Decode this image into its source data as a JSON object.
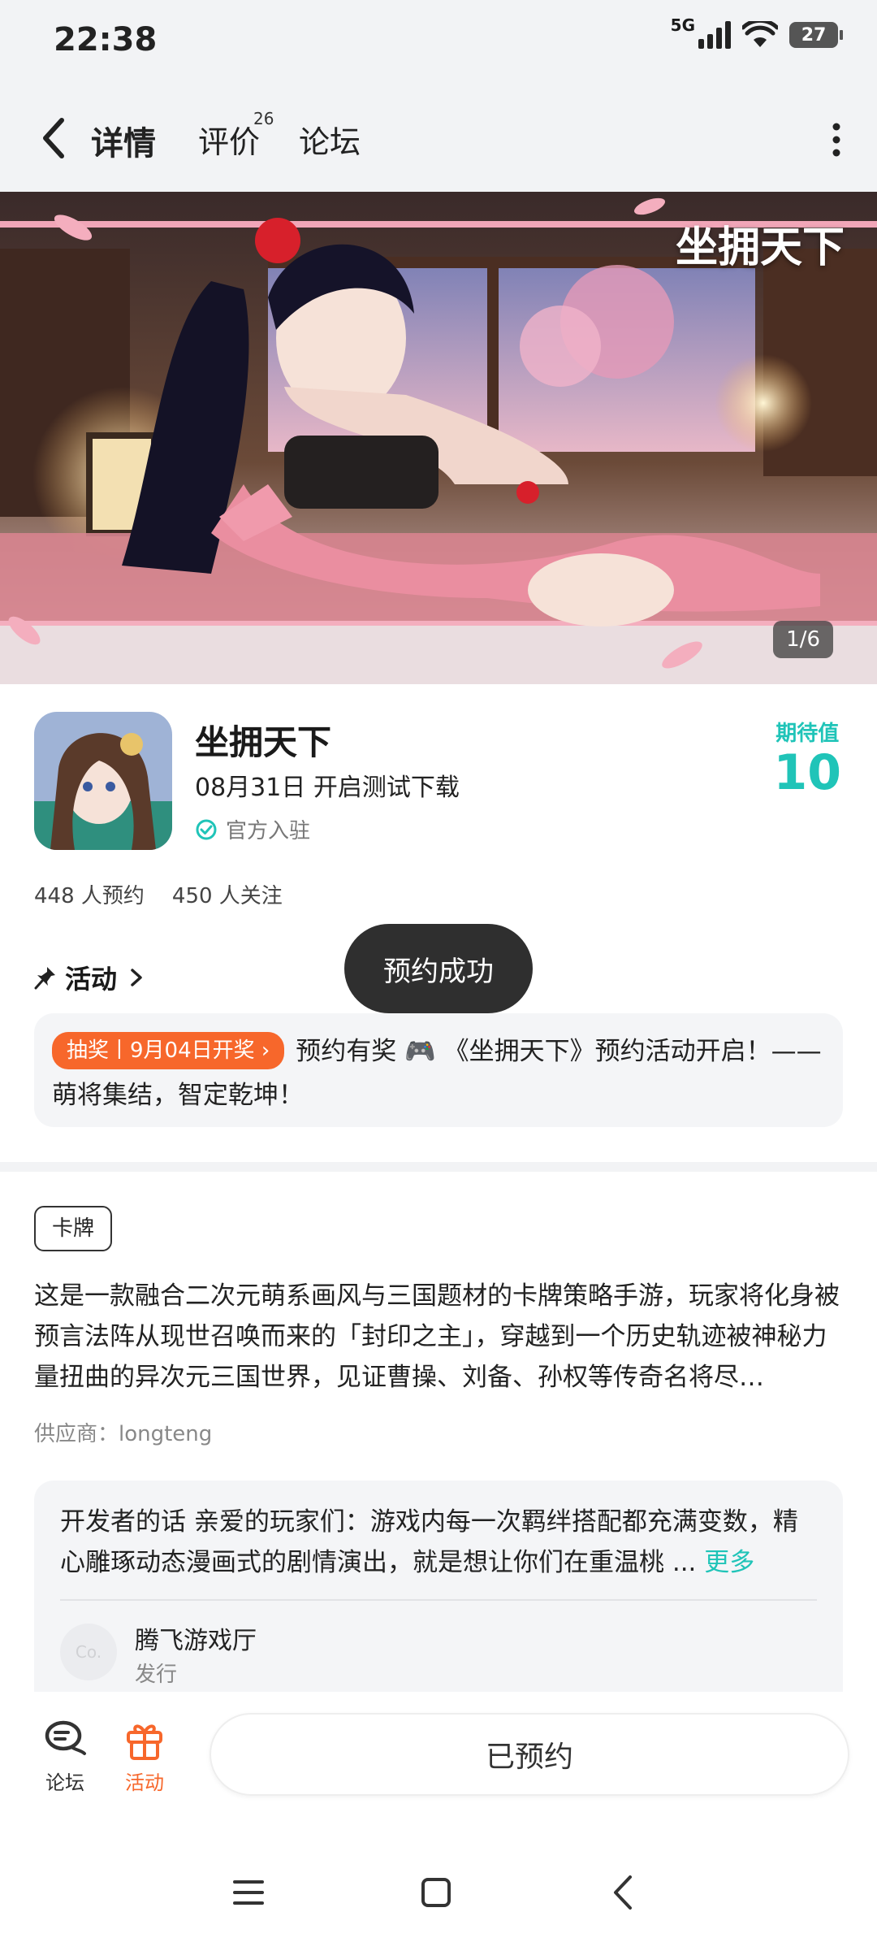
{
  "status_bar": {
    "time": "22:38",
    "network": "5G",
    "battery": "27"
  },
  "nav": {
    "tabs": [
      {
        "label": "详情",
        "active": true
      },
      {
        "label": "评价",
        "badge": "26"
      },
      {
        "label": "论坛"
      }
    ]
  },
  "banner": {
    "logo_text": "坐拥天下",
    "counter": "1/6"
  },
  "app": {
    "name": "坐拥天下",
    "launch": "08月31日 开启测试下载",
    "official_label": "官方入驻",
    "expect_label": "期待值",
    "expect_value": "10",
    "reservations": "448 人预约",
    "followers": "450 人关注"
  },
  "toast": "预约成功",
  "activity": {
    "heading": "活动",
    "tag": "抽奖丨9月04日开奖 ›",
    "text": "预约有奖 🎮 《坐拥天下》预约活动开启！—— 萌将集结，智定乾坤！"
  },
  "genre_tag": "卡牌",
  "description": "这是一款融合二次元萌系画风与三国题材的卡牌策略手游，玩家将化身被预言法阵从现世召唤而来的「封印之主」，穿越到一个历史轨迹被神秘力量扭曲的异次元三国世界，见证曹操、刘备、孙权等传奇名将尽…",
  "vendor": "供应商：longteng",
  "developer": {
    "text": "开发者的话  亲爱的玩家们：游戏内每一次羁绊搭配都充满变数，精心雕琢动态漫画式的剧情演出，就是想让你们在重温桃 ... ",
    "more": "更多",
    "publisher_avatar": "Co.",
    "publisher_name": "腾飞游戏厅",
    "publisher_role": "发行"
  },
  "bottom_bar": {
    "forum_label": "论坛",
    "activity_label": "活动",
    "reserve_button": "已预约"
  },
  "colors": {
    "accent": "#20c4b8",
    "orange": "#f7672b"
  }
}
